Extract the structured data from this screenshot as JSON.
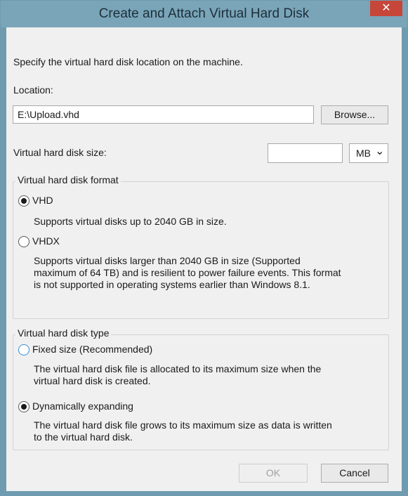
{
  "window": {
    "title": "Create and Attach Virtual Hard Disk",
    "close_glyph": "✕"
  },
  "intro": "Specify the virtual hard disk location on the machine.",
  "location": {
    "label": "Location:",
    "value": "E:\\Upload.vhd",
    "browse_label": "Browse..."
  },
  "size": {
    "label": "Virtual hard disk size:",
    "value": "",
    "unit": "MB",
    "chevron": "⌄"
  },
  "format": {
    "legend": "Virtual hard disk format",
    "options": [
      {
        "label": "VHD",
        "selected": true,
        "desc": [
          "Supports virtual disks up to 2040 GB in size."
        ]
      },
      {
        "label": "VHDX",
        "selected": false,
        "desc": [
          "Supports virtual disks larger than 2040 GB in size (Supported",
          "maximum of 64 TB) and is resilient to power failure events. This format",
          "is not supported in operating systems earlier than Windows 8.1."
        ]
      }
    ]
  },
  "type": {
    "legend": "Virtual hard disk type",
    "options": [
      {
        "label": "Fixed size (Recommended)",
        "selected": false,
        "desc": [
          "The virtual hard disk file is allocated to its maximum size when the",
          "virtual hard disk is created."
        ]
      },
      {
        "label": "Dynamically expanding",
        "selected": true,
        "desc": [
          "The virtual hard disk file grows to its maximum size as data is written",
          "to the virtual hard disk."
        ]
      }
    ]
  },
  "buttons": {
    "ok": "OK",
    "cancel": "Cancel"
  }
}
